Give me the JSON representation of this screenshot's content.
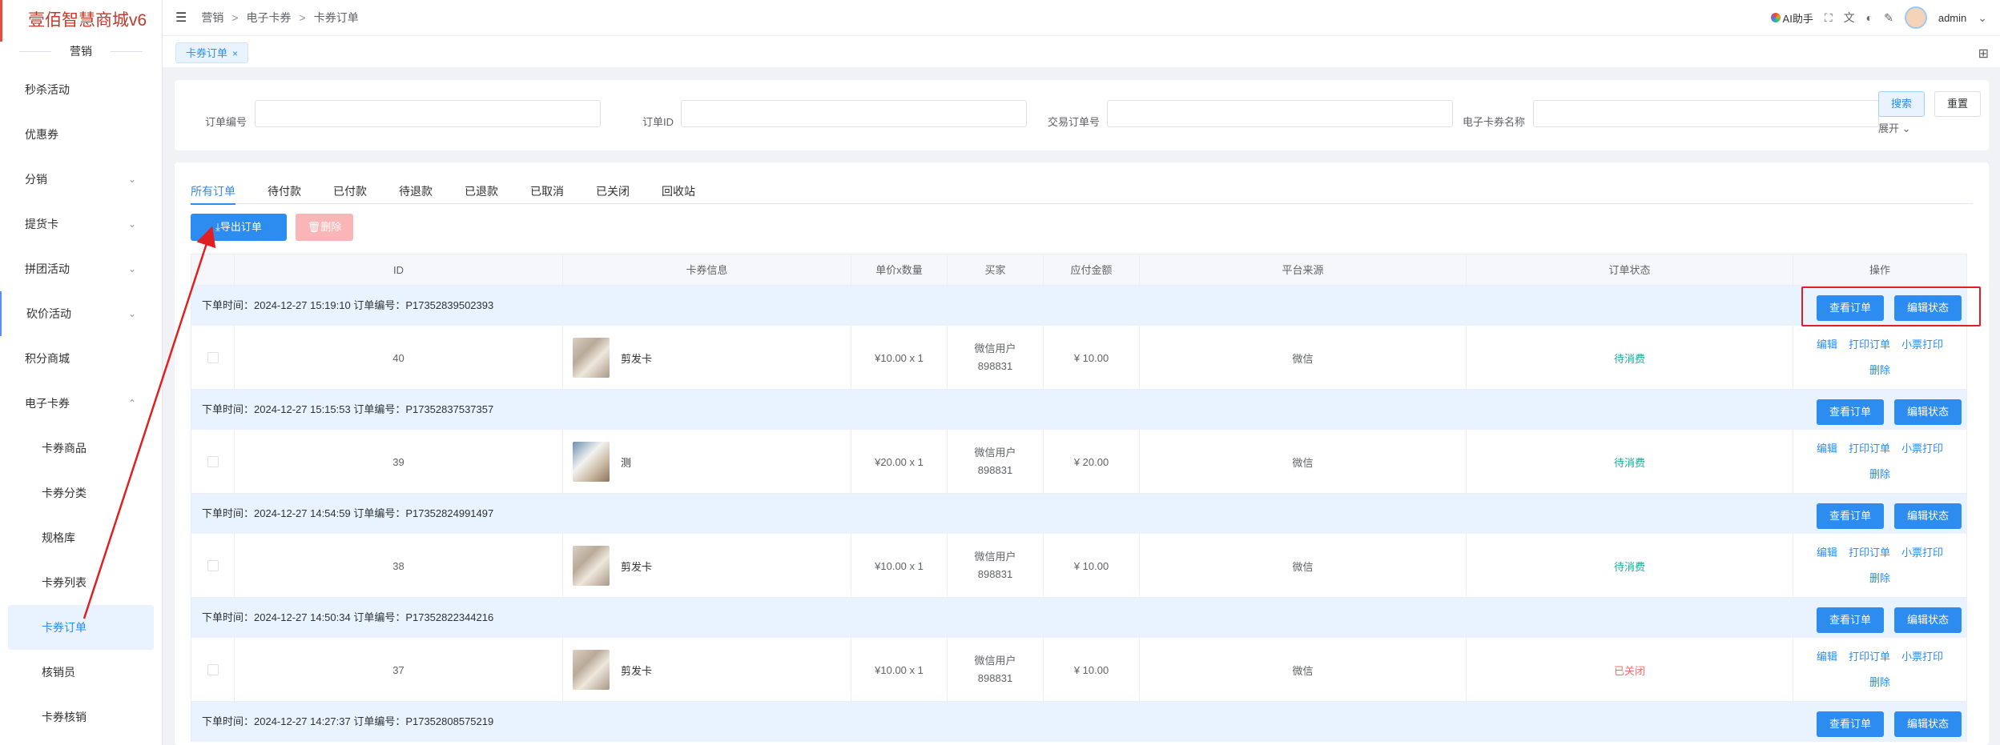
{
  "sidebar": {
    "logo": "壹佰智慧商城v6",
    "section": "营销",
    "items": [
      {
        "label": "秒杀活动",
        "arrow": ""
      },
      {
        "label": "优惠券",
        "arrow": ""
      },
      {
        "label": "分销",
        "arrow": "⌄"
      },
      {
        "label": "提货卡",
        "arrow": "⌄"
      },
      {
        "label": "拼团活动",
        "arrow": "⌄"
      },
      {
        "label": "砍价活动",
        "arrow": "⌄"
      },
      {
        "label": "积分商城",
        "arrow": ""
      },
      {
        "label": "电子卡券",
        "arrow": "⌃"
      }
    ],
    "subitems": [
      "卡券商品",
      "卡券分类",
      "规格库",
      "卡券列表",
      "卡券订单",
      "核销员",
      "卡券核销"
    ]
  },
  "header": {
    "breadcrumb": [
      "营销",
      "电子卡券",
      "卡券订单"
    ],
    "sep": ">",
    "ai_label": "AI助手",
    "user": "admin"
  },
  "page_tab": {
    "label": "卡券订单",
    "close": "×"
  },
  "filters": {
    "order_no_label": "订单编号",
    "order_id_label": "订单ID",
    "trade_no_label": "交易订单号",
    "card_name_label": "电子卡券名称",
    "search": "搜索",
    "reset": "重置",
    "expand": "展开 ⌄"
  },
  "status_tabs": [
    "所有订单",
    "待付款",
    "已付款",
    "待退款",
    "已退款",
    "已取消",
    "已关闭",
    "回收站"
  ],
  "actions": {
    "export": "⤓导出订单",
    "delete": "🗑删除"
  },
  "table": {
    "columns": [
      "ID",
      "卡券信息",
      "单价x数量",
      "买家",
      "应付金额",
      "平台来源",
      "订单状态",
      "操作"
    ],
    "view_btn": "查看订单",
    "edit_status_btn": "编辑状态",
    "ops": [
      "编辑",
      "打印订单",
      "小票打印",
      "删除"
    ],
    "orders": [
      {
        "header": "下单时间：2024-12-27 15:19:10   订单编号：P17352839502393",
        "id": "40",
        "name": "剪发卡",
        "price": "¥10.00 x 1",
        "buyer1": "微信用户",
        "buyer2": "898831",
        "amount": "¥  10.00",
        "source": "微信",
        "status": "待消费",
        "status_color": "green"
      },
      {
        "header": "下单时间：2024-12-27 15:15:53   订单编号：P17352837537357",
        "id": "39",
        "name": "测",
        "price": "¥20.00 x 1",
        "buyer1": "微信用户",
        "buyer2": "898831",
        "amount": "¥  20.00",
        "source": "微信",
        "status": "待消费",
        "status_color": "green"
      },
      {
        "header": "下单时间：2024-12-27 14:54:59   订单编号：P17352824991497",
        "id": "38",
        "name": "剪发卡",
        "price": "¥10.00 x 1",
        "buyer1": "微信用户",
        "buyer2": "898831",
        "amount": "¥  10.00",
        "source": "微信",
        "status": "待消费",
        "status_color": "green"
      },
      {
        "header": "下单时间：2024-12-27 14:50:34   订单编号：P17352822344216",
        "id": "37",
        "name": "剪发卡",
        "price": "¥10.00 x 1",
        "buyer1": "微信用户",
        "buyer2": "898831",
        "amount": "¥  10.00",
        "source": "微信",
        "status": "已关闭",
        "status_color": "red"
      },
      {
        "header": "下单时间：2024-12-27 14:27:37   订单编号：P17352808575219"
      }
    ]
  }
}
